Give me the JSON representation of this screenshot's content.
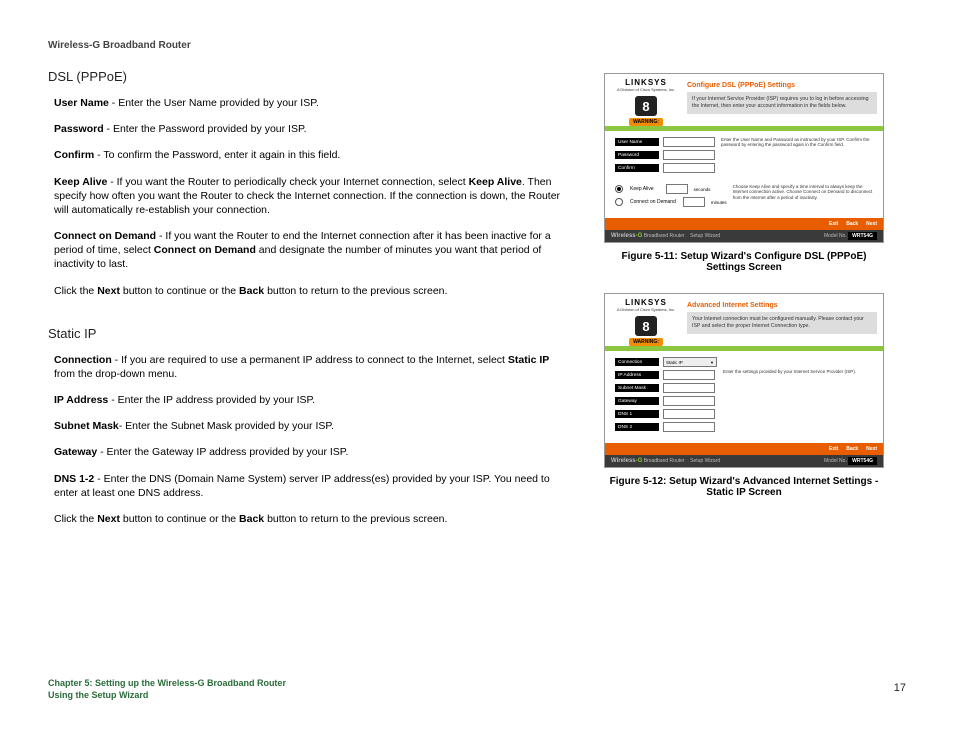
{
  "header": "Wireless-G Broadband Router",
  "sections": {
    "pppoe": {
      "title": "DSL (PPPoE)",
      "p1_b": "User Name",
      "p1_t": " - Enter the User Name provided by your ISP.",
      "p2_b": "Password",
      "p2_t": " - Enter the Password provided by your ISP.",
      "p3_b": "Confirm",
      "p3_t": " - To confirm the Password, enter it again in this field.",
      "p4_b": "Keep Alive",
      "p4_t1": " - If you want the Router to periodically check your Internet connection, select ",
      "p4_b2": "Keep Alive",
      "p4_t2": ". Then specify how often you want the Router to check the Internet connection. If the connection is down, the Router will automatically re-establish your connection.",
      "p5_b": "Connect on Demand",
      "p5_t1": " - If you want the Router to end the Internet connection after it has been inactive for a period of time, select ",
      "p5_b2": "Connect on Demand",
      "p5_t2": " and designate the number of minutes you want that period of inactivity to last.",
      "p6_t1": "Click the ",
      "p6_b1": "Next",
      "p6_t2": " button to continue or the ",
      "p6_b2": "Back",
      "p6_t3": " button to return to the previous screen."
    },
    "static": {
      "title": "Static IP",
      "p1_b": "Connection",
      "p1_t1": " - If you are required to use a permanent IP address to connect to the Internet, select ",
      "p1_b2": "Static IP",
      "p1_t2": " from the drop-down menu.",
      "p2_b": "IP Address",
      "p2_t": " - Enter the IP address provided by your ISP.",
      "p3_b": "Subnet Mask",
      "p3_t": "- Enter the Subnet Mask provided by your ISP.",
      "p4_b": "Gateway",
      "p4_t": " - Enter the Gateway IP address provided by your ISP.",
      "p5_b": "DNS 1-2",
      "p5_t": " - Enter the DNS (Domain Name System) server IP address(es) provided by your ISP. You need to enter at least one DNS address.",
      "p6_t1": "Click the ",
      "p6_b1": "Next",
      "p6_t2": " button to continue or the ",
      "p6_b2": "Back",
      "p6_t3": " button to return to the previous screen."
    }
  },
  "figures": {
    "f1": {
      "brand": "LINKSYS",
      "brand_sub": "A Division of Cisco Systems, Inc.",
      "step": "8",
      "warning": "WARNING:",
      "title": "Configure DSL (PPPoE) Settings",
      "subtitle": "If your Internet Service Provider (ISP) requires you to log in before accessing the Internet, then enter your account information in the fields below.",
      "lbl_user": "User Name",
      "lbl_pass": "Password",
      "lbl_conf": "Confirm",
      "help1": "Enter the User Name and Password as instructed by your ISP. Confirm the password by entering the password again in the Confirm field.",
      "radio1": "Keep Alive",
      "radio2": "Connect on Demand",
      "unit1": "seconds",
      "unit2": "minutes",
      "help2": "Choose Keep Alive and specify a time interval to always keep the Internet connection active. Choose Connect on Demand to disconnect from the Internet after a period of inactivity.",
      "btn_exit": "Exit",
      "btn_back": "Back",
      "btn_next": "Next",
      "footer_wless": "Wireless",
      "footer_g": "-G",
      "footer_prod": " Broadband Router",
      "footer_wizard": "Setup Wizard",
      "footer_modelpre": "Model No.",
      "footer_model": "WRT54G",
      "caption": "Figure 5-11: Setup Wizard's Configure DSL (PPPoE) Settings Screen"
    },
    "f2": {
      "title": "Advanced Internet Settings",
      "subtitle": "Your Internet connection must be configured manually.  Please contact your ISP and select the proper Internet Connection type.",
      "lbl_conn": "Connection",
      "sel_value": "Static IP",
      "lbl_ip": "IP Address",
      "lbl_mask": "Subnet Mask",
      "lbl_gw": "Gateway",
      "lbl_d1": "DNS 1",
      "lbl_d2": "DNS 2",
      "help": "Enter the settings provided by your Internet Service Provider (ISP).",
      "caption": "Figure 5-12: Setup Wizard's Advanced Internet Settings - Static IP Screen"
    }
  },
  "footer": {
    "line1": "Chapter 5: Setting up the Wireless-G Broadband Router",
    "line2": "Using the Setup Wizard",
    "pagenum": "17"
  }
}
